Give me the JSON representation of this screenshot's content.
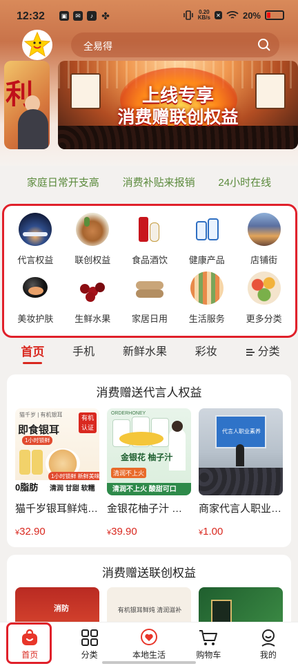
{
  "status_bar": {
    "time": "12:32",
    "net_speed": "0.20",
    "net_unit": "KB/s",
    "battery": "20%"
  },
  "search": {
    "placeholder": "全易得"
  },
  "banner": {
    "side_text": "利",
    "line1": "上线专享",
    "line2": "消费赠联创权益"
  },
  "features": [
    "家庭日常开支高",
    "消费补贴来报销",
    "24小时在线"
  ],
  "categories": [
    {
      "label": "代言权益",
      "icon": "city-night-icon"
    },
    {
      "label": "联创权益",
      "icon": "food-bowl-icon"
    },
    {
      "label": "食品酒饮",
      "icon": "liquor-bottle-icon"
    },
    {
      "label": "健康产品",
      "icon": "supplement-bottles-icon"
    },
    {
      "label": "店铺街",
      "icon": "shop-street-icon"
    },
    {
      "label": "美妆护肤",
      "icon": "cosmetic-compact-icon"
    },
    {
      "label": "生鲜水果",
      "icon": "cherries-icon"
    },
    {
      "label": "家居日用",
      "icon": "towels-icon"
    },
    {
      "label": "生活服务",
      "icon": "supermarket-icon"
    },
    {
      "label": "更多分类",
      "icon": "more-categories-icon"
    }
  ],
  "tabs": [
    {
      "label": "首页",
      "active": true
    },
    {
      "label": "手机",
      "active": false
    },
    {
      "label": "新鲜水果",
      "active": false
    },
    {
      "label": "彩妆",
      "active": false
    },
    {
      "label": "分类",
      "active": false
    }
  ],
  "section1": {
    "title": "消费赠送代言人权益",
    "products": [
      {
        "name": "猫千岁银耳鲜炖即食…",
        "price_symbol": "¥",
        "price": "32.90",
        "img_text": {
          "brand": "猫千岁 | 有机银耳",
          "badge_top": "有机",
          "badge_bottom": "认证",
          "headline": "即食银耳",
          "tag": "1小时锁鲜",
          "corner_a": "0脂肪",
          "corner_b": "清润 甘甜 软糯",
          "corner_c": "1小时锁鲜 新鲜美味"
        }
      },
      {
        "name": "金银花柚子汁 …",
        "price_symbol": "¥",
        "price": "39.90",
        "img_text": {
          "brand": "ORDERHONEY",
          "headline": "金银花 柚子汁",
          "badge": "清润不上火",
          "tag": "清润不上火 酸甜可口"
        }
      },
      {
        "name": "商家代言人职业素养…",
        "price_symbol": "¥",
        "price": "1.00",
        "img_text": {
          "screen_title": "代言人职业素养"
        }
      }
    ]
  },
  "section2": {
    "title": "消费赠送联创权益",
    "preview_texts": [
      "消防",
      "有机银耳鲜炖 清润滋补"
    ]
  },
  "bottom_nav": [
    {
      "label": "首页",
      "icon": "home-bag-icon",
      "active": true
    },
    {
      "label": "分类",
      "icon": "grid-icon",
      "active": false
    },
    {
      "label": "本地生活",
      "icon": "heart-pin-icon",
      "active": false
    },
    {
      "label": "购物车",
      "icon": "cart-icon",
      "active": false
    },
    {
      "label": "我的",
      "icon": "profile-icon",
      "active": false
    }
  ],
  "colors": {
    "accent": "#d9281f",
    "feature_text": "#5b8a3c",
    "highlight_border": "#e0202a"
  }
}
